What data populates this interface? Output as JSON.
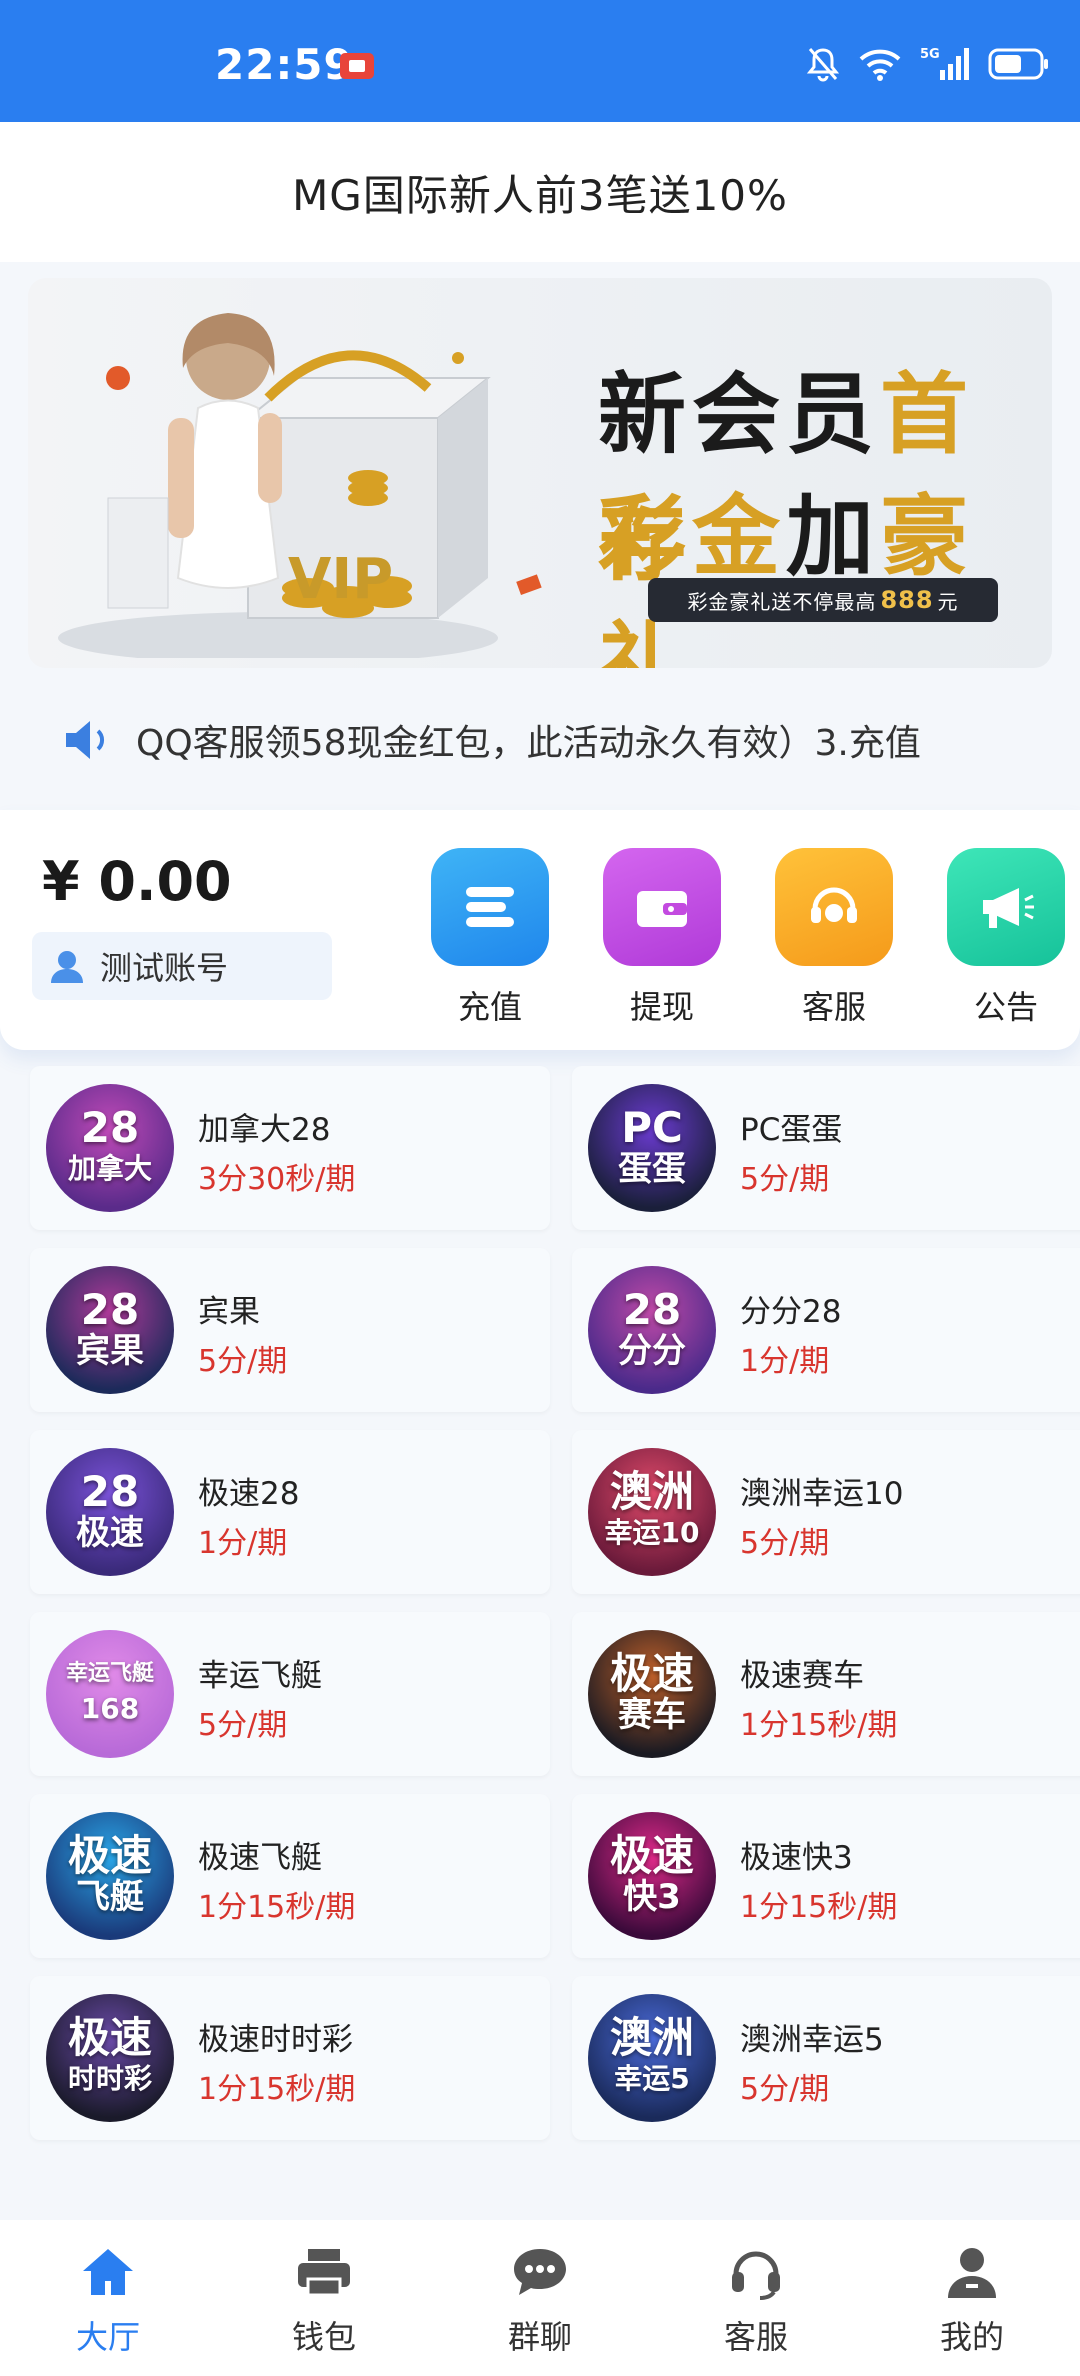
{
  "status_bar": {
    "time": "22:59",
    "network": "5G"
  },
  "header": {
    "title": "MG国际新人前3笔送10%"
  },
  "banner": {
    "line1_a": "新会员",
    "line1_b": "首存",
    "line2_a": "彩金",
    "line2_b": "加",
    "line2_c": "豪礼",
    "pill_pre": "彩金豪礼送不停最高",
    "pill_num": "888",
    "pill_post": "元",
    "vip_mark": "VIP"
  },
  "notice": {
    "text": "QQ客服领58现金红包，此活动永久有效）3.充值"
  },
  "wallet": {
    "balance": "¥ 0.00",
    "account": "测试账号",
    "actions": [
      {
        "label": "充值",
        "icon": "recharge-icon",
        "color": "#2a9cf0"
      },
      {
        "label": "提现",
        "icon": "wallet-icon",
        "color": "#c34ae0"
      },
      {
        "label": "客服",
        "icon": "support-icon",
        "color": "#f6a623"
      },
      {
        "label": "公告",
        "icon": "megaphone-icon",
        "color": "#22d3a6"
      }
    ]
  },
  "games": [
    {
      "name": "加拿大28",
      "period": "3分30秒/期",
      "logo_line1": "28",
      "logo_line2": "加拿大",
      "colors": [
        "#5a2b8a",
        "#c04ab8"
      ]
    },
    {
      "name": "PC蛋蛋",
      "period": "5分/期",
      "logo_line1": "PC",
      "logo_line2": "蛋蛋",
      "colors": [
        "#1a1f3a",
        "#6b3bd1"
      ]
    },
    {
      "name": "宾果",
      "period": "5分/期",
      "logo_line1": "28",
      "logo_line2": "宾果",
      "colors": [
        "#1c2a5a",
        "#b03a9a"
      ]
    },
    {
      "name": "分分28",
      "period": "1分/期",
      "logo_line1": "28",
      "logo_line2": "分分",
      "colors": [
        "#4a2a8a",
        "#c04aa8"
      ]
    },
    {
      "name": "极速28",
      "period": "1分/期",
      "logo_line1": "28",
      "logo_line2": "极速",
      "colors": [
        "#3a2a7a",
        "#7a52d8"
      ]
    },
    {
      "name": "澳洲幸运10",
      "period": "5分/期",
      "logo_line1": "澳洲",
      "logo_line2": "幸运10",
      "colors": [
        "#6a1a3a",
        "#e04a6a"
      ]
    },
    {
      "name": "幸运飞艇",
      "period": "5分/期",
      "logo_line1": "幸运飞艇",
      "logo_line2": "168",
      "colors": [
        "#b86ad8",
        "#e08ae8"
      ]
    },
    {
      "name": "极速赛车",
      "period": "1分15秒/期",
      "logo_line1": "极速",
      "logo_line2": "赛车",
      "colors": [
        "#1a1a22",
        "#c0602a"
      ]
    },
    {
      "name": "极速飞艇",
      "period": "1分15秒/期",
      "logo_line1": "极速",
      "logo_line2": "飞艇",
      "colors": [
        "#1a3a7a",
        "#2aa6e8"
      ]
    },
    {
      "name": "极速快3",
      "period": "1分15秒/期",
      "logo_line1": "极速",
      "logo_line2": "快3",
      "colors": [
        "#3a0a3a",
        "#e02a8a"
      ]
    },
    {
      "name": "极速时时彩",
      "period": "1分15秒/期",
      "logo_line1": "极速",
      "logo_line2": "时时彩",
      "colors": [
        "#1a1a2a",
        "#6a4aa8"
      ]
    },
    {
      "name": "澳洲幸运5",
      "period": "5分/期",
      "logo_line1": "澳洲",
      "logo_line2": "幸运5",
      "colors": [
        "#1a2a5a",
        "#4a6ad8"
      ]
    }
  ],
  "tabbar": [
    {
      "label": "大厅",
      "icon": "home-icon",
      "active": true
    },
    {
      "label": "钱包",
      "icon": "printer-icon",
      "active": false
    },
    {
      "label": "群聊",
      "icon": "chat-icon",
      "active": false
    },
    {
      "label": "客服",
      "icon": "headset-icon",
      "active": false
    },
    {
      "label": "我的",
      "icon": "user-icon",
      "active": false
    }
  ],
  "colors": {
    "primary": "#2a7ef0",
    "period_red": "#d8352e",
    "gold": "#d7a024"
  }
}
